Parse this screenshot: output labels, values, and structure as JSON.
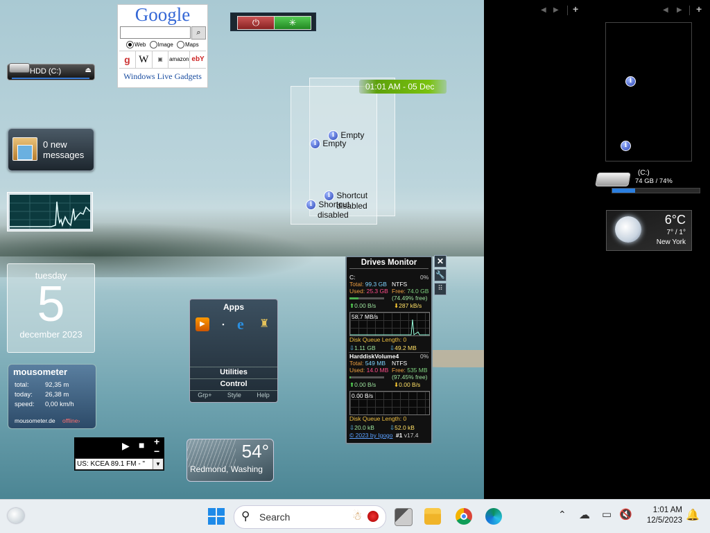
{
  "power_gadget": {
    "power_icon": "power-icon",
    "sleep_icon": "sleep-icon"
  },
  "google": {
    "logo": "Google",
    "search_placeholder": "",
    "options": [
      "Web",
      "Image",
      "Maps"
    ],
    "selected": "Web",
    "shortcuts": [
      "google",
      "W",
      "YouTube",
      "amazon",
      "ebY"
    ],
    "footer": "Windows Live Gadgets"
  },
  "hdd": {
    "label": "HDD (C:)"
  },
  "mail": {
    "text_line1": "0 new",
    "text_line2": "messages"
  },
  "calendar": {
    "weekday": "tuesday",
    "day": "5",
    "month_year": "december 2023"
  },
  "mousometer": {
    "title": "mousometer",
    "rows": [
      {
        "label": "total:",
        "value": "92,35 m"
      },
      {
        "label": "today:",
        "value": "26,38 m"
      },
      {
        "label": "speed:",
        "value": "0,00 km/h"
      }
    ],
    "site": "mousometer.de",
    "status": "offline"
  },
  "radio": {
    "station": "US: KCEA 89.1 FM - \""
  },
  "weather_small": {
    "temp": "54°",
    "city": "Redmond, Washing"
  },
  "apps": {
    "title": "Apps",
    "section1": "Utilities",
    "section2": "Control",
    "footer": [
      "Grp+",
      "Style",
      "Help"
    ]
  },
  "clock": {
    "text": "01:01 AM - 05 Dec"
  },
  "notes": {
    "empty_label": "Empty",
    "shortcut_line1": "Shortcut",
    "shortcut_line2": "disabled"
  },
  "drives_monitor": {
    "title": "Drives Monitor",
    "c": {
      "name": "C:",
      "pct": "0%",
      "total_label": "Total:",
      "total": "99.3 GB",
      "fs": "NTFS",
      "used_label": "Used:",
      "used": "25.3 GB",
      "free_label": "Free:",
      "free": "74.0 GB",
      "free_pct": "(74.49% free)",
      "read": "0.00 B/s",
      "write": "287 kB/s",
      "graph_label": "58.7 MB/s",
      "queue": "Disk Queue Length: 0",
      "read_total": "1.11 GB",
      "write_total": "49.2 MB"
    },
    "h": {
      "name": "HarddiskVolume4",
      "pct": "0%",
      "total_label": "Total:",
      "total": "549 MB",
      "fs": "NTFS",
      "used_label": "Used:",
      "used": "14.0 MB",
      "free_label": "Free:",
      "free": "535 MB",
      "free_pct": "(97.45% free)",
      "read": "0.00 B/s",
      "write": "0.00 B/s",
      "graph_label": "0.00 B/s",
      "queue": "Disk Queue Length: 0",
      "read_total": "20.0 kB",
      "write_total": "52.0 kB"
    },
    "footer_left": "© 2023 by Igogo",
    "footer_num": "#1",
    "footer_ver": "v17.4"
  },
  "sidebar": {
    "drive_label": "(C:)",
    "drive_info": "74 GB / 74%",
    "drive_usage": 0.26,
    "weather_temp": "6°C",
    "weather_range": "7° / 1°",
    "weather_city": "New York"
  },
  "taskbar": {
    "search_label": "Search",
    "time": "1:01 AM",
    "date": "12/5/2023"
  }
}
